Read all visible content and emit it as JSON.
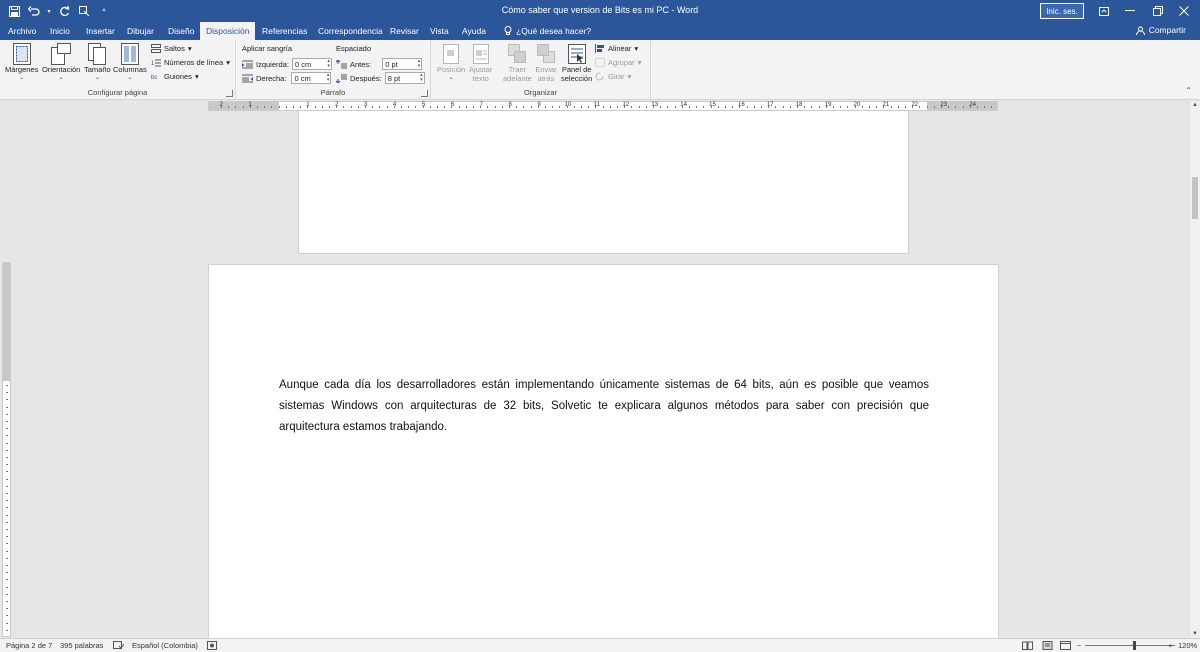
{
  "window": {
    "title": "Cómo saber que version de Bits es mi PC  -  Word",
    "signin_label": "Inic. ses.",
    "share_label": "Compartir"
  },
  "tabs": [
    {
      "label": "Archivo"
    },
    {
      "label": "Inicio"
    },
    {
      "label": "Insertar"
    },
    {
      "label": "Dibujar"
    },
    {
      "label": "Diseño"
    },
    {
      "label": "Disposición",
      "active": true
    },
    {
      "label": "Referencias"
    },
    {
      "label": "Correspondencia"
    },
    {
      "label": "Revisar"
    },
    {
      "label": "Vista"
    },
    {
      "label": "Ayuda"
    }
  ],
  "tellme": "¿Qué desea hacer?",
  "ribbon": {
    "configurar": {
      "group_label": "Configurar página",
      "margins": "Márgenes",
      "orientation": "Orientación",
      "size": "Tamaño",
      "columns": "Columnas",
      "breaks": "Saltos",
      "line_numbers": "Números de línea",
      "hyphenation": "Guiones"
    },
    "parrafo": {
      "group_label": "Párrafo",
      "indent_title": "Aplicar sangría",
      "left_label": "Izquierda:",
      "left_value": "0 cm",
      "right_label": "Derecha:",
      "right_value": "0 cm",
      "spacing_title": "Espaciado",
      "before_label": "Antes:",
      "before_value": "0 pt",
      "after_label": "Después:",
      "after_value": "8 pt"
    },
    "organizar": {
      "group_label": "Organizar",
      "position_1": "Posición",
      "wrap_1": "Ajustar",
      "wrap_2": "texto",
      "forward_1": "Traer",
      "forward_2": "adelante",
      "backward_1": "Enviar",
      "backward_2": "atrás",
      "pane_1": "Panel de",
      "pane_2": "selección",
      "align": "Alinear",
      "group": "Agrupar",
      "rotate": "Girar"
    }
  },
  "ruler_numbers": [
    "2",
    "1",
    "1",
    "2",
    "3",
    "4",
    "5",
    "6",
    "7",
    "8",
    "9",
    "10",
    "11",
    "12",
    "13",
    "14",
    "15",
    "16",
    "17",
    "18",
    "19",
    "20",
    "21",
    "22",
    "23",
    "24",
    "25"
  ],
  "document": {
    "paragraph": "Aunque cada día los desarrolladores están implementando únicamente sistemas de 64 bits, aún es posible que veamos sistemas Windows con arquitecturas de 32 bits, Solvetic te explicara algunos métodos para saber con precisión que arquitectura estamos trabajando."
  },
  "status": {
    "page": "Página 2 de 7",
    "words": "395 palabras",
    "language": "Español (Colombia)",
    "zoom": "120%"
  },
  "colors": {
    "word_blue": "#2b579a",
    "ribbon_bg": "#f3f3f3",
    "canvas_bg": "#e6e6e6"
  }
}
